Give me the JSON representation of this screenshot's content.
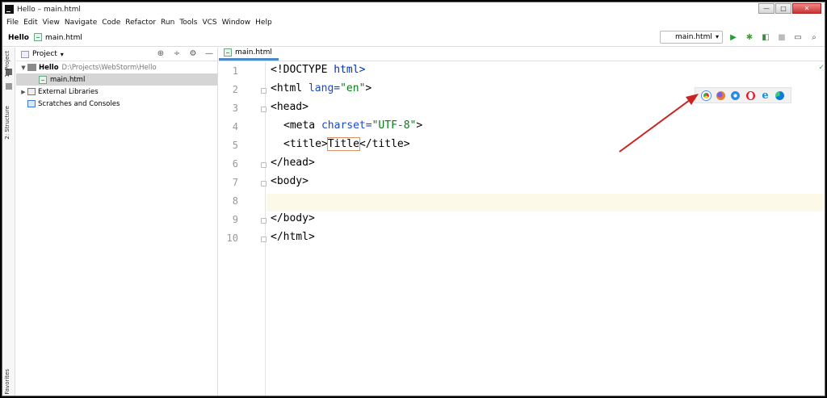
{
  "window": {
    "title": "Hello – main.html",
    "min_glyph": "—",
    "max_glyph": "□",
    "close_glyph": "✕"
  },
  "menu": [
    "File",
    "Edit",
    "View",
    "Navigate",
    "Code",
    "Refactor",
    "Run",
    "Tools",
    "VCS",
    "Window",
    "Help"
  ],
  "breadcrumb": {
    "project": "Hello",
    "file": "main.html"
  },
  "toolbar": {
    "run_config": "main.html"
  },
  "tool_strip": {
    "project": "1: Project",
    "structure": "2: Structure",
    "favorites": "Favorites"
  },
  "project_panel": {
    "title": "Project",
    "tree": {
      "root_name": "Hello",
      "root_path": "D:\\Projects\\WebStorm\\Hello",
      "file": "main.html",
      "libs": "External Libraries",
      "scratches": "Scratches and Consoles"
    }
  },
  "editor": {
    "tab": "main.html",
    "line_numbers": [
      "1",
      "2",
      "3",
      "4",
      "5",
      "6",
      "7",
      "8",
      "9",
      "10"
    ],
    "code": {
      "l1": "<!DOCTYPE",
      "l1b": " html>",
      "l2a": "<html",
      "l2b": " lang=",
      "l2c": "\"en\"",
      "l2d": ">",
      "l3": "<head>",
      "l4a": "<meta",
      "l4b": " charset=",
      "l4c": "\"UTF-8\"",
      "l4d": ">",
      "l5a": "<title>",
      "l5b": "Title",
      "l5c": "</title>",
      "l6": "</head>",
      "l7": "<body>",
      "l9": "</body>",
      "l10": "</html>"
    }
  },
  "colors": {
    "accent": "#4a88c7",
    "arrow": "#cc2222",
    "tag": "#0033b3",
    "string": "#067d17"
  },
  "browsers": [
    "chrome-icon",
    "firefox-icon",
    "safari-icon",
    "opera-icon",
    "ie-icon",
    "edge-icon"
  ]
}
